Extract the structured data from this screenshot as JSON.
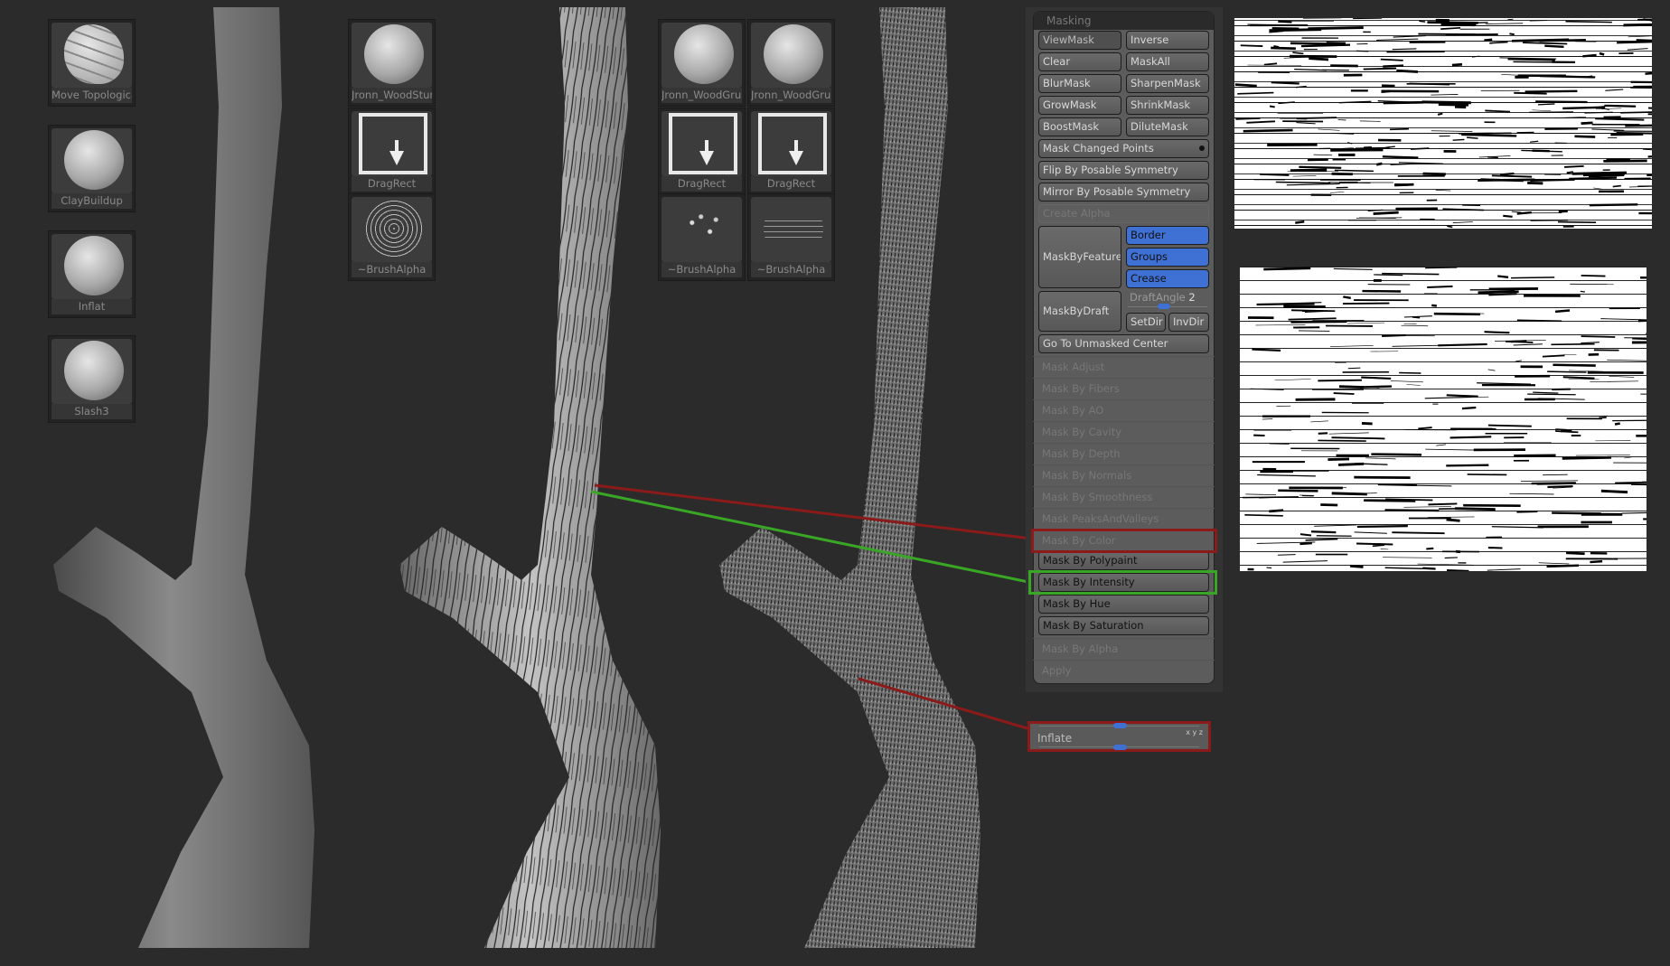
{
  "left_brushes": [
    {
      "label": "Move Topologica"
    },
    {
      "label": "ClayBuildup"
    },
    {
      "label": "Inflat"
    },
    {
      "label": "Slash3"
    }
  ],
  "brush_set_1": {
    "brush": "Jronn_WoodStum",
    "stroke": "DragRect",
    "alpha": "~BrushAlpha"
  },
  "brush_set_2": {
    "brush": "Jronn_WoodGrur",
    "stroke": "DragRect",
    "alpha": "~BrushAlpha"
  },
  "brush_set_3": {
    "brush": "Jronn_WoodGrur",
    "stroke": "DragRect",
    "alpha": "~BrushAlpha"
  },
  "masking": {
    "title": "Masking",
    "viewmask": "ViewMask",
    "inverse": "Inverse",
    "clear": "Clear",
    "maskall": "MaskAll",
    "blurmask": "BlurMask",
    "sharpenmask": "SharpenMask",
    "growmask": "GrowMask",
    "shrinkmask": "ShrinkMask",
    "boostmask": "BoostMask",
    "dilutemask": "DiluteMask",
    "mask_changed_points": "Mask Changed Points",
    "flip": "Flip By Posable Symmetry",
    "mirror": "Mirror By Posable Symmetry",
    "create_alpha": "Create Alpha",
    "maskbyfeature": "MaskByFeature",
    "border": "Border",
    "groups": "Groups",
    "crease": "Crease",
    "maskbydraft": "MaskByDraft",
    "draftangle_label": "DraftAngle",
    "draftangle_value": "2",
    "setdir": "SetDir",
    "invdir": "InvDir",
    "goto": "Go To Unmasked Center",
    "list": [
      "Mask Adjust",
      "Mask By Fibers",
      "Mask By AO",
      "Mask By Cavity",
      "Mask By Depth",
      "Mask By Normals",
      "Mask By Smoothness",
      "Mask PeaksAndValleys",
      "Mask By Color",
      "Mask By Polypaint",
      "Mask By Intensity",
      "Mask By Hue",
      "Mask By Saturation",
      "Mask By Alpha",
      "Apply"
    ]
  },
  "inflate": {
    "label": "Inflate",
    "axes": "x y z"
  },
  "colors": {
    "red": "#8b1a1a",
    "green": "#3aa626",
    "blue": "#3f70d4"
  }
}
